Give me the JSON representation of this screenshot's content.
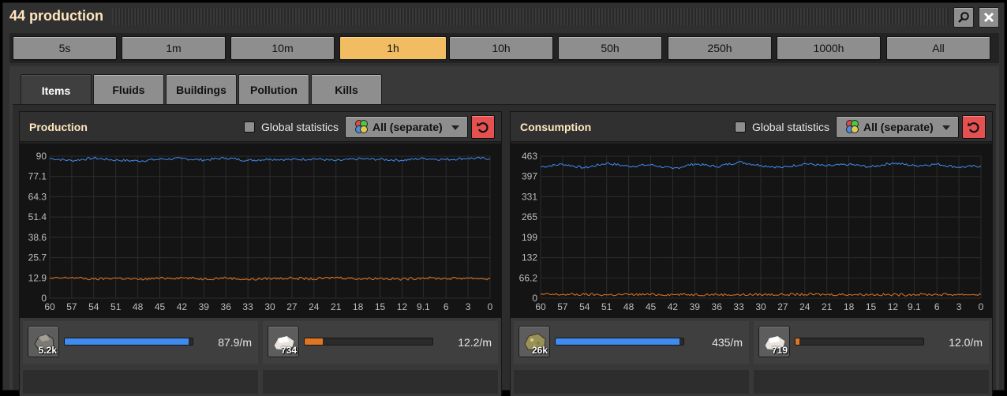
{
  "window": {
    "title": "44 production"
  },
  "time_ranges": [
    "5s",
    "1m",
    "10m",
    "1h",
    "10h",
    "50h",
    "250h",
    "1000h",
    "All"
  ],
  "selected_time_range": "1h",
  "tabs": [
    "Items",
    "Fluids",
    "Buildings",
    "Pollution",
    "Kills"
  ],
  "active_tab": "Items",
  "colors": {
    "accent": "#f2bd62",
    "series_blue": "#3f8cf0",
    "series_orange": "#e07522",
    "reset": "#e55050"
  },
  "production": {
    "title": "Production",
    "global_label": "Global statistics",
    "dropdown": "All (separate)",
    "chart_data": {
      "type": "line",
      "x": [
        60,
        57,
        54,
        51,
        48,
        45,
        42,
        39,
        36,
        33,
        30,
        27,
        24,
        21,
        18,
        15,
        12,
        9.1,
        6,
        3,
        0
      ],
      "xticks": [
        "60",
        "57",
        "54",
        "51",
        "48",
        "45",
        "42",
        "39",
        "36",
        "33",
        "30",
        "27",
        "24",
        "21",
        "18",
        "15",
        "12",
        "9.1",
        "6",
        "3",
        "0"
      ],
      "yticks": [
        "0",
        "12.9",
        "25.7",
        "38.6",
        "51.4",
        "64.3",
        "77.1",
        "90"
      ],
      "ylim": [
        0,
        90
      ],
      "grid": true,
      "series": [
        {
          "color": "#3f8cf0",
          "values": [
            88.6,
            87.2,
            88.8,
            87.5,
            87.0,
            88.1,
            88.5,
            87.6,
            88.9,
            87.3,
            88.2,
            87.8,
            88.4,
            87.1,
            88.3,
            88.0,
            87.4,
            88.6,
            87.9,
            88.7,
            88.5
          ]
        },
        {
          "color": "#e07522",
          "values": [
            12.4,
            13.1,
            12.0,
            12.8,
            11.9,
            12.6,
            13.0,
            12.2,
            12.9,
            11.8,
            12.5,
            12.7,
            12.1,
            13.2,
            12.3,
            12.6,
            12.0,
            12.9,
            12.4,
            12.8,
            12.2
          ]
        }
      ]
    },
    "items": [
      {
        "icon": "stone-icon",
        "count": "5.2k",
        "rate": "87.9/m",
        "fill": 0.97,
        "color": "#3f8cf0"
      },
      {
        "icon": "stone-brick-icon",
        "count": "734",
        "rate": "12.2/m",
        "fill": 0.14,
        "color": "#e07522"
      }
    ]
  },
  "consumption": {
    "title": "Consumption",
    "global_label": "Global statistics",
    "dropdown": "All (separate)",
    "chart_data": {
      "type": "line",
      "x": [
        60,
        57,
        54,
        51,
        48,
        45,
        42,
        39,
        36,
        33,
        30,
        27,
        24,
        21,
        18,
        15,
        12,
        9.1,
        6,
        3,
        0
      ],
      "xticks": [
        "60",
        "57",
        "54",
        "51",
        "48",
        "45",
        "42",
        "39",
        "36",
        "33",
        "30",
        "27",
        "24",
        "21",
        "18",
        "15",
        "12",
        "9.1",
        "6",
        "3",
        "0"
      ],
      "yticks": [
        "0",
        "66.2",
        "132",
        "199",
        "265",
        "331",
        "397",
        "463"
      ],
      "ylim": [
        0,
        463
      ],
      "grid": true,
      "series": [
        {
          "color": "#3f8cf0",
          "values": [
            428,
            437,
            425,
            440,
            430,
            435,
            422,
            438,
            429,
            444,
            433,
            426,
            439,
            431,
            436,
            428,
            441,
            432,
            437,
            427,
            431
          ]
        },
        {
          "color": "#e07522",
          "values": [
            12,
            12,
            12,
            11,
            12,
            12,
            12,
            12,
            12,
            11,
            12,
            12,
            12,
            12,
            12,
            12,
            11,
            12,
            12,
            12,
            12
          ]
        }
      ]
    },
    "items": [
      {
        "icon": "sulfur-ore-icon",
        "count": "26k",
        "rate": "435/m",
        "fill": 0.97,
        "color": "#3f8cf0"
      },
      {
        "icon": "stone-brick-icon",
        "count": "719",
        "rate": "12.0/m",
        "fill": 0.03,
        "color": "#e07522"
      }
    ]
  }
}
